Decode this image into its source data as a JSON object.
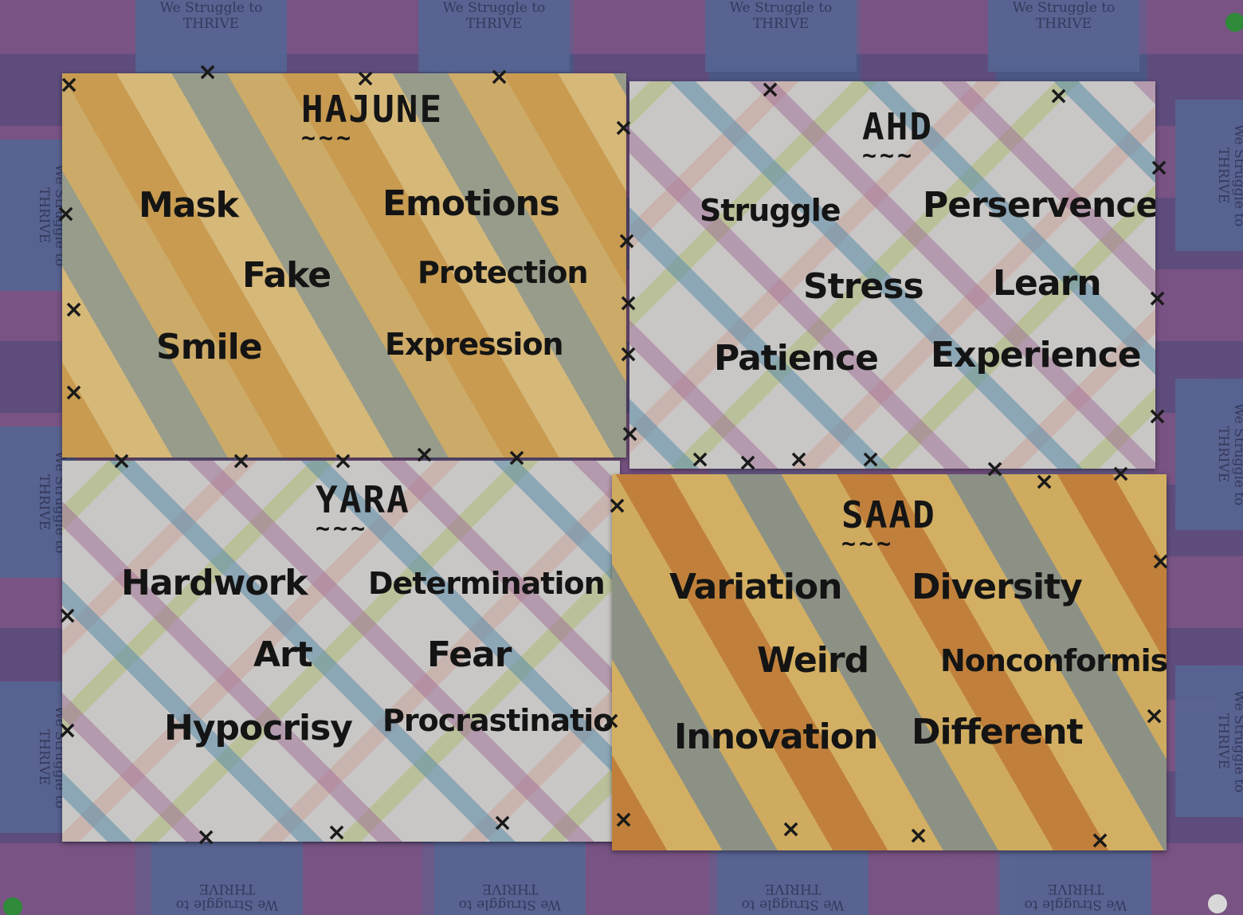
{
  "tile_text": "We Struggle to THRIVE",
  "cards": [
    {
      "title": "HAJUNE",
      "words": [
        "Mask",
        "Emotions",
        "Fake",
        "Protection",
        "Smile",
        "Expression"
      ]
    },
    {
      "title": "AHD",
      "words": [
        "Struggle",
        "Perservence",
        "Stress",
        "Learn",
        "Patience",
        "Experience"
      ]
    },
    {
      "title": "YARA",
      "words": [
        "Hardwork",
        "Determination",
        "Art",
        "Fear",
        "Hypocrisy",
        "Procrastination"
      ]
    },
    {
      "title": "SAAD",
      "words": [
        "Variation",
        "Diversity",
        "Weird",
        "Nonconformism",
        "Innovation",
        "Different"
      ]
    }
  ],
  "colors": {
    "pin_green": "#2f8a3a",
    "pin_white": "#d8d8d8"
  }
}
